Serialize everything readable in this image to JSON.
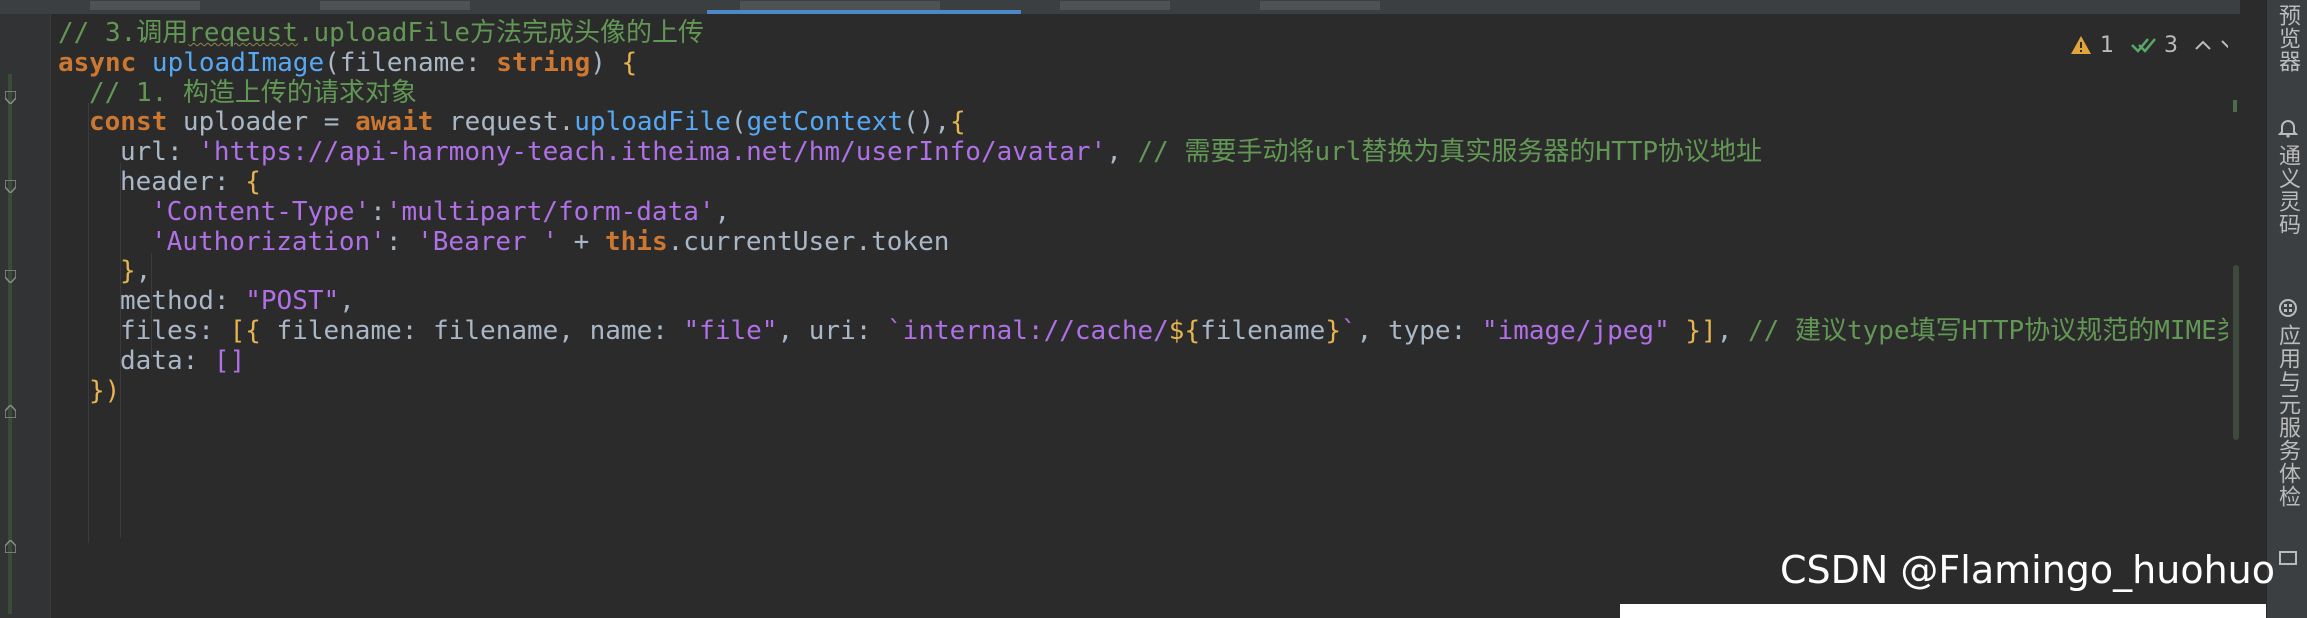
{
  "editor": {
    "inspections": {
      "warnings": "1",
      "ok": "3"
    },
    "lines": [
      {
        "indent": 0,
        "tokens": [
          {
            "t": "// 3.调用",
            "c": "c-com"
          },
          {
            "t": "reqeust",
            "c": "c-com squiggle"
          },
          {
            "t": ".uploadFile方法完成头像的上传",
            "c": "c-com"
          }
        ]
      },
      {
        "indent": 0,
        "tokens": [
          {
            "t": "async ",
            "c": "c-kw"
          },
          {
            "t": "uploadImage",
            "c": "c-fn"
          },
          {
            "t": "(filename: ",
            "c": "c-def"
          },
          {
            "t": "string",
            "c": "c-kw"
          },
          {
            "t": ") ",
            "c": "c-def"
          },
          {
            "t": "{",
            "c": "c-brk"
          }
        ]
      },
      {
        "indent": 1,
        "tokens": [
          {
            "t": "// 1. 构造上传的请求对象",
            "c": "c-com"
          }
        ]
      },
      {
        "indent": 1,
        "tokens": [
          {
            "t": "const ",
            "c": "c-kw"
          },
          {
            "t": "uploader = ",
            "c": "c-def"
          },
          {
            "t": "await ",
            "c": "c-kw"
          },
          {
            "t": "request.",
            "c": "c-def"
          },
          {
            "t": "uploadFile",
            "c": "c-fn"
          },
          {
            "t": "(",
            "c": "c-def"
          },
          {
            "t": "getContext",
            "c": "c-fn"
          },
          {
            "t": "(),",
            "c": "c-def"
          },
          {
            "t": "{",
            "c": "c-brk"
          }
        ]
      },
      {
        "indent": 2,
        "tokens": [
          {
            "t": "url: ",
            "c": "c-def"
          },
          {
            "t": "'https://api-harmony-teach.itheima.net/hm/userInfo/avatar'",
            "c": "c-str"
          },
          {
            "t": ", ",
            "c": "c-def"
          },
          {
            "t": "// 需要手动将url替换为真实服务器的HTTP协议地址",
            "c": "c-com"
          }
        ]
      },
      {
        "indent": 2,
        "tokens": [
          {
            "t": "header: ",
            "c": "c-def"
          },
          {
            "t": "{",
            "c": "c-brk"
          }
        ]
      },
      {
        "indent": 3,
        "tokens": [
          {
            "t": "'Content-Type'",
            "c": "c-str"
          },
          {
            "t": ":",
            "c": "c-def"
          },
          {
            "t": "'multipart/form-data'",
            "c": "c-str"
          },
          {
            "t": ",",
            "c": "c-def"
          }
        ]
      },
      {
        "indent": 3,
        "tokens": [
          {
            "t": "'Authorization'",
            "c": "c-str"
          },
          {
            "t": ": ",
            "c": "c-def"
          },
          {
            "t": "'Bearer '",
            "c": "c-str"
          },
          {
            "t": " + ",
            "c": "c-def"
          },
          {
            "t": "this",
            "c": "c-kw"
          },
          {
            "t": ".currentUser.token",
            "c": "c-def"
          }
        ]
      },
      {
        "indent": 2,
        "tokens": [
          {
            "t": "}",
            "c": "c-brk"
          },
          {
            "t": ",",
            "c": "c-def"
          }
        ]
      },
      {
        "indent": 2,
        "tokens": [
          {
            "t": "method: ",
            "c": "c-def"
          },
          {
            "t": "\"POST\"",
            "c": "c-str"
          },
          {
            "t": ",",
            "c": "c-def"
          }
        ]
      },
      {
        "indent": 2,
        "tokens": [
          {
            "t": "files: ",
            "c": "c-def"
          },
          {
            "t": "[{",
            "c": "c-brk"
          },
          {
            "t": " filename: filename, name: ",
            "c": "c-def"
          },
          {
            "t": "\"file\"",
            "c": "c-str"
          },
          {
            "t": ", uri: ",
            "c": "c-def"
          },
          {
            "t": "`internal://cache/",
            "c": "c-str"
          },
          {
            "t": "${",
            "c": "c-brk"
          },
          {
            "t": "filename",
            "c": "c-def"
          },
          {
            "t": "}",
            "c": "c-brk"
          },
          {
            "t": "`",
            "c": "c-str"
          },
          {
            "t": ", type: ",
            "c": "c-def"
          },
          {
            "t": "\"image/jpeg\"",
            "c": "c-str"
          },
          {
            "t": " ",
            "c": "c-def"
          },
          {
            "t": "}]",
            "c": "c-brk"
          },
          {
            "t": ", ",
            "c": "c-def"
          },
          {
            "t": "// 建议type填写HTTP协议规范的MIME类型",
            "c": "c-com"
          }
        ]
      },
      {
        "indent": 2,
        "tokens": [
          {
            "t": "data: ",
            "c": "c-def"
          },
          {
            "t": "[]",
            "c": "c-str"
          }
        ]
      },
      {
        "indent": 1,
        "tokens": [
          {
            "t": "})",
            "c": "c-brk"
          }
        ]
      }
    ]
  },
  "right_panel": {
    "tools": [
      {
        "name": "tool-previewer",
        "label": "预览器"
      },
      {
        "name": "tool-notifications",
        "label": "通义灵码"
      },
      {
        "name": "tool-app-services",
        "label": "应用与元服务体检"
      }
    ]
  },
  "watermark": "CSDN @Flamingo_huohuo"
}
